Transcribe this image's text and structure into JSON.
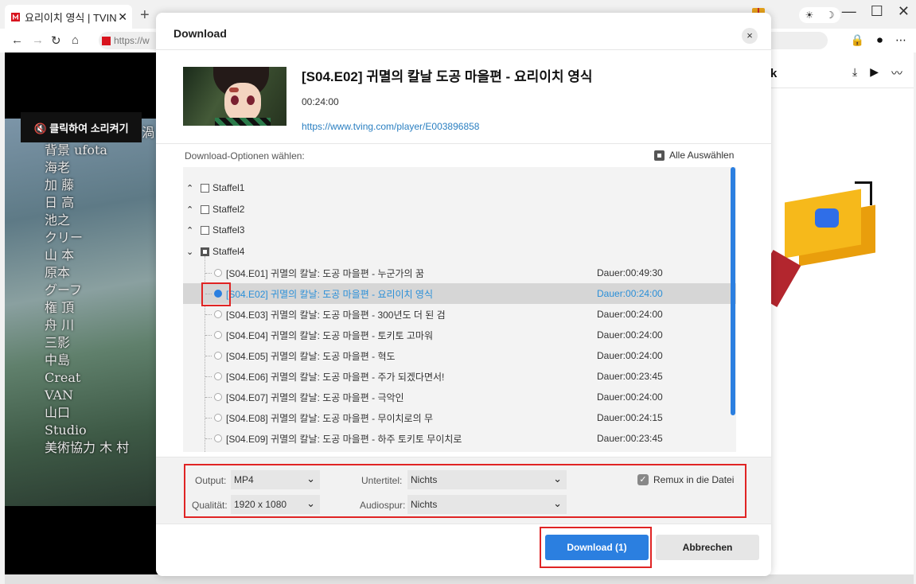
{
  "browser": {
    "tab_title": "요리이치 영식 | TVIN",
    "tab_close": "✕",
    "new_tab": "+",
    "url_partial": "https://w",
    "nav": {
      "back": "←",
      "forward": "→",
      "reload": "↻",
      "home": "⌂"
    },
    "win": {
      "minimize": "—",
      "maximize": "☐",
      "close": "✕"
    },
    "toolbar": {
      "lock": "🔒",
      "record": "⏺",
      "more": "⋯"
    }
  },
  "page": {
    "sound_button": "🔇 클릭하여 소리켜기",
    "credits": [
      "美術監督補佐 猿 渦",
      "背景 ufota",
      "海老",
      "加 藤",
      "日 高",
      "池之",
      "クリー",
      "山 本",
      "原本",
      "グーフ",
      "権 頂",
      "舟 川",
      "三影",
      "中島",
      "Creat",
      "VAN",
      "山口",
      "Studio",
      "美術協力 木 村"
    ],
    "right_panel": {
      "letter": "k",
      "icons": {
        "download": "⤓",
        "video": "▶",
        "audio": "〰"
      }
    }
  },
  "dialog": {
    "title": "Download",
    "close": "×",
    "video": {
      "title": "[S04.E02] 귀멸의 칼날 도공 마을편 - 요리이치 영식",
      "duration": "00:24:00",
      "url": "https://www.tving.com/player/E003896858"
    },
    "options_label": "Download-Optionen wählen:",
    "select_all": "Alle Auswählen",
    "seasons": [
      {
        "label": "Staffel1",
        "chevron": "^"
      },
      {
        "label": "Staffel2",
        "chevron": "^"
      },
      {
        "label": "Staffel3",
        "chevron": "^"
      },
      {
        "label": "Staffel4",
        "chevron": "v"
      }
    ],
    "episodes": [
      {
        "title": "[S04.E01] 귀멸의 칼날: 도공 마을편 - 누군가의 꿈",
        "duration": "Dauer:00:49:30",
        "selected": false
      },
      {
        "title": "[S04.E02] 귀멸의 칼날: 도공 마을편 - 요리이치 영식",
        "duration": "Dauer:00:24:00",
        "selected": true
      },
      {
        "title": "[S04.E03] 귀멸의 칼날: 도공 마을편 - 300년도 더 된 검",
        "duration": "Dauer:00:24:00",
        "selected": false
      },
      {
        "title": "[S04.E04] 귀멸의 칼날: 도공 마을편 - 토키토 고마워",
        "duration": "Dauer:00:24:00",
        "selected": false
      },
      {
        "title": "[S04.E05] 귀멸의 칼날: 도공 마을편 - 혁도",
        "duration": "Dauer:00:24:00",
        "selected": false
      },
      {
        "title": "[S04.E06] 귀멸의 칼날: 도공 마을편 - 주가 되겠다면서!",
        "duration": "Dauer:00:23:45",
        "selected": false
      },
      {
        "title": "[S04.E07] 귀멸의 칼날: 도공 마을편 - 극악인",
        "duration": "Dauer:00:24:00",
        "selected": false
      },
      {
        "title": "[S04.E08] 귀멸의 칼날: 도공 마을편 - 무이치로의 무",
        "duration": "Dauer:00:24:15",
        "selected": false
      },
      {
        "title": "[S04.E09] 귀멸의 칼날: 도공 마을편 - 하주 토키토 무이치로",
        "duration": "Dauer:00:23:45",
        "selected": false
      }
    ],
    "settings": {
      "output_label": "Output:",
      "output_value": "MP4",
      "quality_label": "Qualität:",
      "quality_value": "1920 x 1080",
      "subtitle_label": "Untertitel:",
      "subtitle_value": "Nichts",
      "audio_label": "Audiospur:",
      "audio_value": "Nichts",
      "remux_label": "Remux in die Datei",
      "remux_checked": true
    },
    "buttons": {
      "download": "Download (1)",
      "cancel": "Abbrechen"
    }
  },
  "colors": {
    "accent": "#2b7fe0",
    "highlight": "#e02424",
    "brand": "#d8141e"
  }
}
